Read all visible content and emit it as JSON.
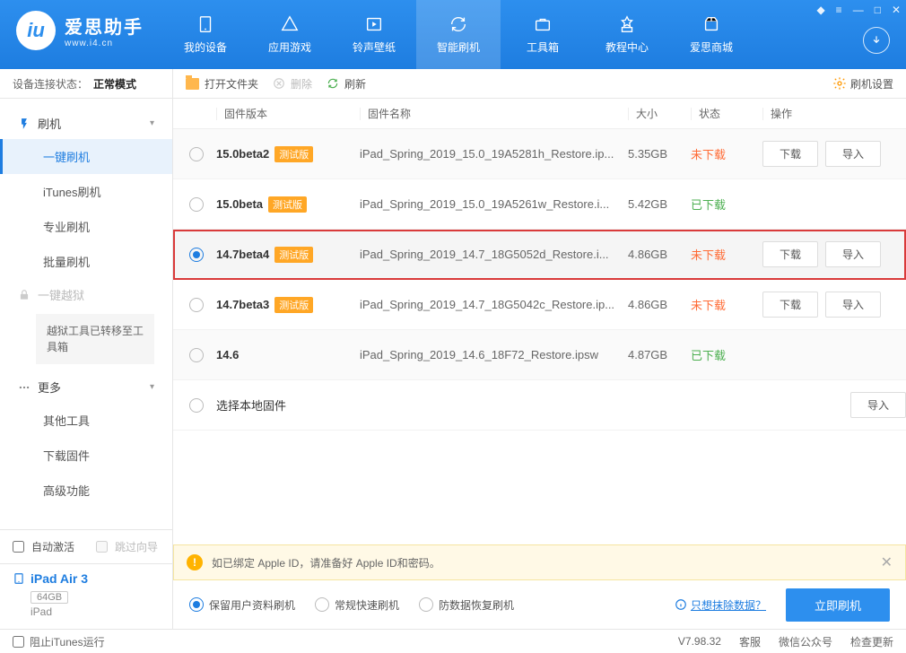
{
  "app": {
    "name": "爱思助手",
    "sub": "www.i4.cn"
  },
  "topnav": [
    {
      "label": "我的设备"
    },
    {
      "label": "应用游戏"
    },
    {
      "label": "铃声壁纸"
    },
    {
      "label": "智能刷机"
    },
    {
      "label": "工具箱"
    },
    {
      "label": "教程中心"
    },
    {
      "label": "爱思商城"
    }
  ],
  "conn": {
    "label": "设备连接状态：",
    "mode": "正常模式"
  },
  "side": {
    "flash": "刷机",
    "items": [
      "一键刷机",
      "iTunes刷机",
      "专业刷机",
      "批量刷机"
    ],
    "jailbreak": "一键越狱",
    "jb_note": "越狱工具已转移至工具箱",
    "more": "更多",
    "more_items": [
      "其他工具",
      "下载固件",
      "高级功能"
    ]
  },
  "side_bottom": {
    "auto_activate": "自动激活",
    "skip_guide": "跳过向导",
    "device_name": "iPad Air 3",
    "device_cap": "64GB",
    "device_type": "iPad"
  },
  "toolbar": {
    "open": "打开文件夹",
    "delete": "删除",
    "refresh": "刷新",
    "settings": "刷机设置"
  },
  "cols": {
    "ver": "固件版本",
    "name": "固件名称",
    "size": "大小",
    "status": "状态",
    "actions": "操作"
  },
  "tags": {
    "beta": "测试版"
  },
  "status": {
    "no": "未下载",
    "yes": "已下载"
  },
  "btns": {
    "download": "下载",
    "import": "导入"
  },
  "rows": [
    {
      "ver": "15.0beta2",
      "beta": true,
      "name": "iPad_Spring_2019_15.0_19A5281h_Restore.ip...",
      "size": "5.35GB",
      "status": "no",
      "dl": true,
      "imp": true
    },
    {
      "ver": "15.0beta",
      "beta": true,
      "name": "iPad_Spring_2019_15.0_19A5261w_Restore.i...",
      "size": "5.42GB",
      "status": "yes",
      "dl": false,
      "imp": false
    },
    {
      "ver": "14.7beta4",
      "beta": true,
      "name": "iPad_Spring_2019_14.7_18G5052d_Restore.i...",
      "size": "4.86GB",
      "status": "no",
      "dl": true,
      "imp": true,
      "selected": true,
      "highlight": true
    },
    {
      "ver": "14.7beta3",
      "beta": true,
      "name": "iPad_Spring_2019_14.7_18G5042c_Restore.ip...",
      "size": "4.86GB",
      "status": "no",
      "dl": true,
      "imp": true
    },
    {
      "ver": "14.6",
      "beta": false,
      "name": "iPad_Spring_2019_14.6_18F72_Restore.ipsw",
      "size": "4.87GB",
      "status": "yes",
      "dl": false,
      "imp": false
    }
  ],
  "local_row": "选择本地固件",
  "banner": "如已绑定 Apple ID，请准备好 Apple ID和密码。",
  "footer": {
    "opts": [
      "保留用户资料刷机",
      "常规快速刷机",
      "防数据恢复刷机"
    ],
    "erase_link": "只想抹除数据？",
    "flash_now": "立即刷机"
  },
  "statusbar": {
    "block_itunes": "阻止iTunes运行",
    "version_label": "V7.98.32",
    "support": "客服",
    "wechat": "微信公众号",
    "update": "检查更新"
  }
}
